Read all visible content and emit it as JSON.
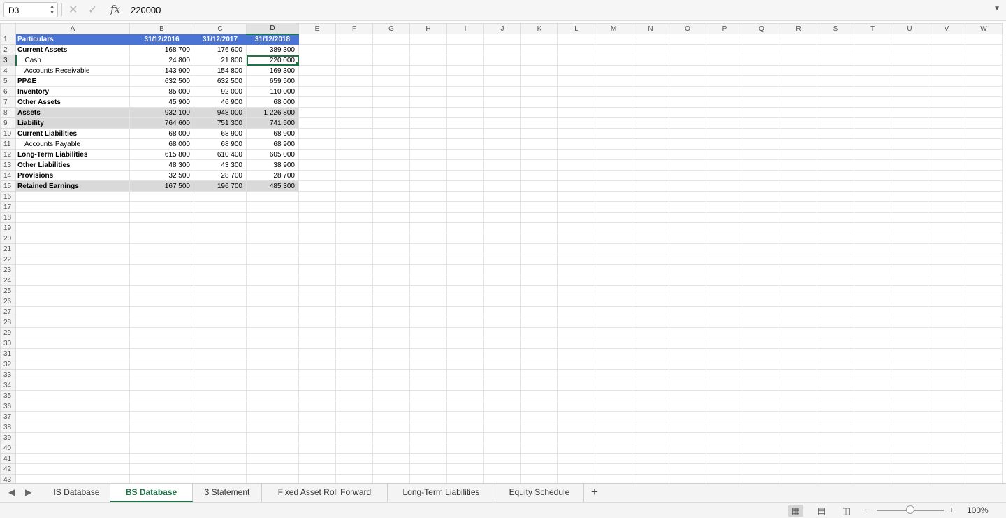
{
  "formula_bar": {
    "name_box": "D3",
    "formula": "220000"
  },
  "columns": [
    "A",
    "B",
    "C",
    "D",
    "E",
    "F",
    "G",
    "H",
    "I",
    "J",
    "K",
    "L",
    "M",
    "N",
    "O",
    "P",
    "Q",
    "R",
    "S",
    "T",
    "U",
    "V",
    "W"
  ],
  "active_cell": {
    "col": "D",
    "row": 3
  },
  "data_rows": [
    {
      "cells": [
        "Particulars",
        "31/12/2016",
        "31/12/2017",
        "31/12/2018"
      ],
      "style": "header"
    },
    {
      "cells": [
        "Current Assets",
        "168 700",
        "176 600",
        "389 300"
      ],
      "style": "bold"
    },
    {
      "cells": [
        "Cash",
        "24 800",
        "21 800",
        "220 000"
      ],
      "style": "indent"
    },
    {
      "cells": [
        "Accounts Receivable",
        "143 900",
        "154 800",
        "169 300"
      ],
      "style": "indent"
    },
    {
      "cells": [
        "PP&E",
        "632 500",
        "632 500",
        "659 500"
      ],
      "style": "bold"
    },
    {
      "cells": [
        "Inventory",
        "85 000",
        "92 000",
        "110 000"
      ],
      "style": "bold"
    },
    {
      "cells": [
        "Other Assets",
        "45 900",
        "46 900",
        "68 000"
      ],
      "style": "bold"
    },
    {
      "cells": [
        "Assets",
        "932 100",
        "948 000",
        "1 226 800"
      ],
      "style": "total"
    },
    {
      "cells": [
        "Liability",
        "764 600",
        "751 300",
        "741 500"
      ],
      "style": "total"
    },
    {
      "cells": [
        "Current Liabilities",
        "68 000",
        "68 900",
        "68 900"
      ],
      "style": "bold"
    },
    {
      "cells": [
        "Accounts Payable",
        "68 000",
        "68 900",
        "68 900"
      ],
      "style": "indent"
    },
    {
      "cells": [
        "Long-Term Liabilities",
        "615 800",
        "610 400",
        "605 000"
      ],
      "style": "bold"
    },
    {
      "cells": [
        "Other Liabilities",
        "48 300",
        "43 300",
        "38 900"
      ],
      "style": "bold"
    },
    {
      "cells": [
        "Provisions",
        "32 500",
        "28 700",
        "28 700"
      ],
      "style": "bold"
    },
    {
      "cells": [
        "Retained Earnings",
        "167 500",
        "196 700",
        "485 300"
      ],
      "style": "total"
    }
  ],
  "row_count": 43,
  "sheet_tabs": [
    {
      "label": "IS Database",
      "active": false
    },
    {
      "label": "BS Database",
      "active": true
    },
    {
      "label": "3 Statement",
      "active": false
    },
    {
      "label": "Fixed Asset Roll Forward",
      "active": false
    },
    {
      "label": "Long-Term Liabilities",
      "active": false
    },
    {
      "label": "Equity Schedule",
      "active": false
    }
  ],
  "status_bar": {
    "zoom_level": "100%"
  },
  "colors": {
    "accent": "#1f7345",
    "header_fill": "#4a74d4",
    "total_fill": "#d9d9d9"
  },
  "icons": [
    "cancel-icon",
    "enter-icon",
    "fx-icon",
    "expand-icon",
    "tab-prev-icon",
    "tab-next-icon",
    "add-sheet-icon",
    "normal-view-icon",
    "page-layout-icon",
    "page-break-icon",
    "zoom-out-icon",
    "zoom-in-icon"
  ]
}
